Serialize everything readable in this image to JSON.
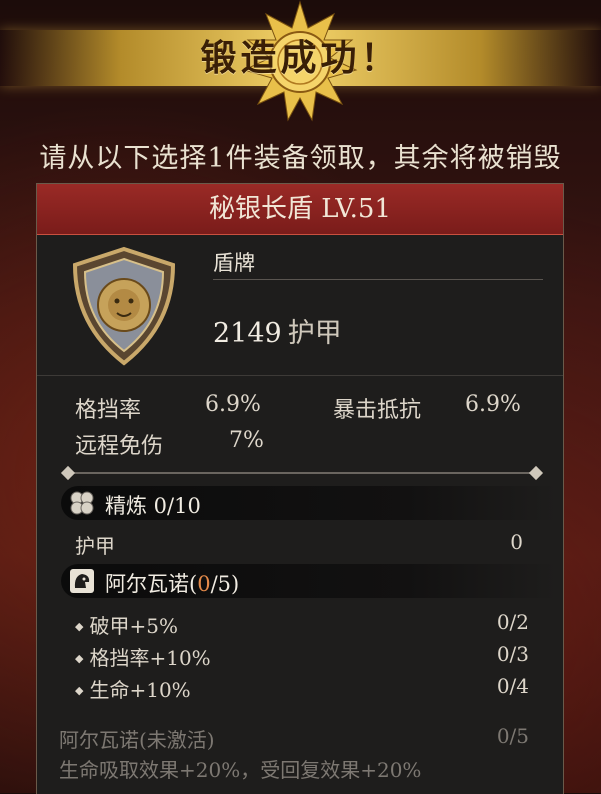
{
  "banner": {
    "title": "锻造成功！"
  },
  "subtitle": "请从以下选择1件装备领取，其余将被销毁",
  "item": {
    "name": "秘银长盾 LV.51",
    "type": "盾牌",
    "armor_value": "2149",
    "armor_unit": "护甲",
    "stats": [
      {
        "label": "格挡率",
        "value": "6.9%"
      },
      {
        "label": "暴击抵抗",
        "value": "6.9%"
      },
      {
        "label": "远程免伤",
        "value": "7%"
      }
    ]
  },
  "refine": {
    "title": "精炼 0/10",
    "icon": "hexagon-cluster-icon",
    "rows": [
      {
        "label": "护甲",
        "value": "0"
      }
    ]
  },
  "set": {
    "title_prefix": "阿尔瓦诺(",
    "title_count": "0",
    "title_suffix": "/5)",
    "icon": "lion-head-icon",
    "bonuses": [
      {
        "label": "破甲+5%",
        "value": "0/2"
      },
      {
        "label": "格挡率+10%",
        "value": "0/3"
      },
      {
        "label": "生命+10%",
        "value": "0/4"
      }
    ],
    "inactive_label": "阿尔瓦诺(未激活)",
    "inactive_value": "0/5",
    "inactive_desc": "生命吸取效果+20%，受回复效果+20%"
  },
  "colors": {
    "header_red": "#8a2420",
    "gold": "#f3d36a",
    "highlight_orange": "#e48a4a"
  }
}
